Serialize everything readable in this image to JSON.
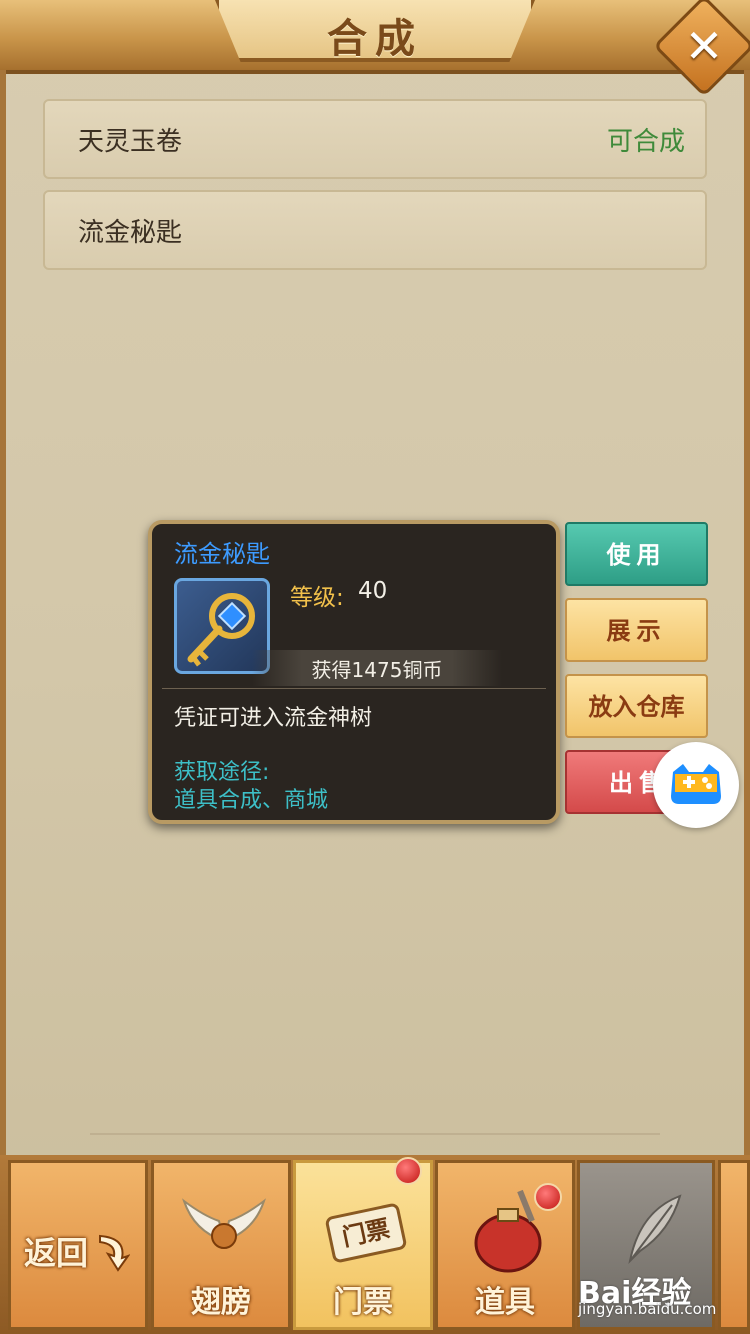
{
  "header": {
    "title": "合成",
    "close_glyph": "✕"
  },
  "list": {
    "items": [
      {
        "name": "天灵玉卷",
        "status": "可合成"
      },
      {
        "name": "流金秘匙",
        "status": ""
      }
    ]
  },
  "tooltip": {
    "item_name": "流金秘匙",
    "level_label": "等级:",
    "level_value": "40",
    "coin_text": "获得1475铜币",
    "description": "凭证可进入流金神树",
    "source_label": "获取途径:",
    "source_value": "道具合成、商城",
    "icon": "golden-key-icon"
  },
  "actions": {
    "use": "使用",
    "show": "展示",
    "store": "放入仓库",
    "sell": "出售"
  },
  "tabs": {
    "back": "返回",
    "wing": "翅膀",
    "ticket": "门票",
    "ticket_scroll": "门票",
    "props": "道具"
  },
  "watermark": {
    "main": "Bai经验",
    "sub": "jingyan.baidu.com"
  },
  "colors": {
    "status_green": "#3f8a3a",
    "item_name_blue": "#3d9bff",
    "source_cyan": "#3dbfc7",
    "level_gold": "#f2c14b",
    "use_btn": "#3fb39a",
    "sell_btn": "#e05a5a"
  }
}
